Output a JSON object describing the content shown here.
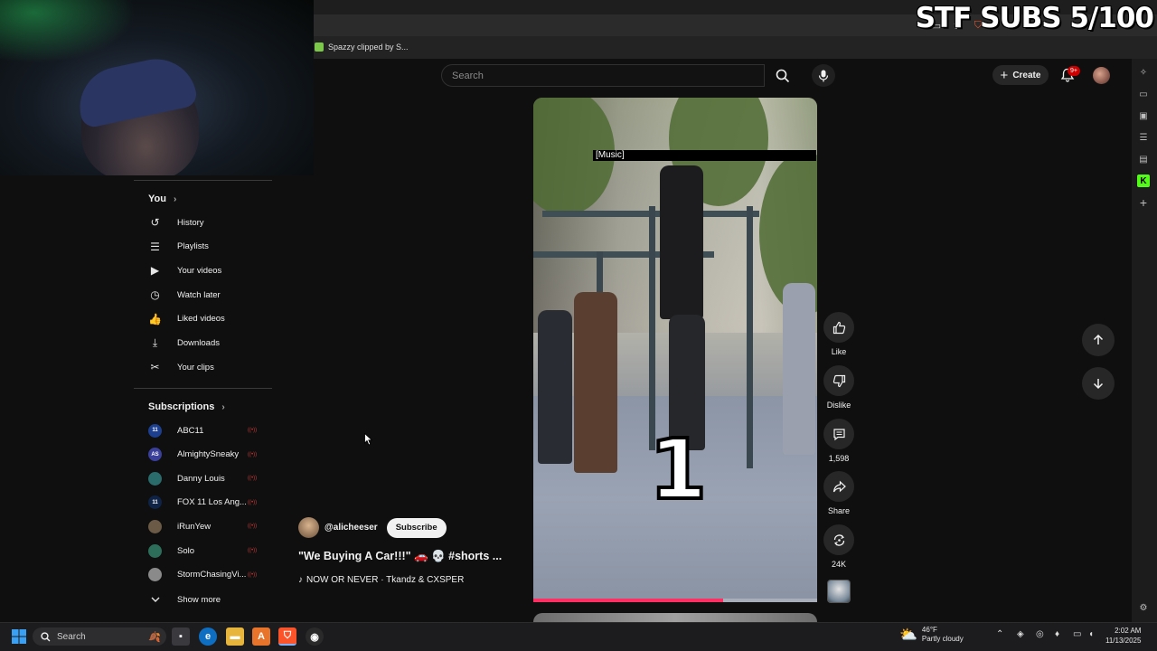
{
  "browser": {
    "bookmark_label": "Spazzy clipped by S...",
    "stream_overlay": "STF SUBS 5/100"
  },
  "masthead": {
    "search_placeholder": "Search",
    "create_label": "Create",
    "notification_badge": "9+"
  },
  "sidebar": {
    "you_heading": "You",
    "you_items": [
      {
        "label": "History",
        "icon": "history-icon"
      },
      {
        "label": "Playlists",
        "icon": "playlists-icon"
      },
      {
        "label": "Your videos",
        "icon": "your-videos-icon"
      },
      {
        "label": "Watch later",
        "icon": "watch-later-icon"
      },
      {
        "label": "Liked videos",
        "icon": "liked-videos-icon"
      },
      {
        "label": "Downloads",
        "icon": "downloads-icon"
      },
      {
        "label": "Your clips",
        "icon": "clips-icon"
      }
    ],
    "subscriptions_heading": "Subscriptions",
    "subscriptions": [
      {
        "label": "ABC11",
        "avatar_color": "#1d3f8f",
        "avatar_text": "11"
      },
      {
        "label": "AlmightySneaky",
        "avatar_color": "#3a3f9a",
        "avatar_text": "AS"
      },
      {
        "label": "Danny Louis",
        "avatar_color": "#2a6b6b",
        "avatar_text": ""
      },
      {
        "label": "FOX 11 Los Ang...",
        "avatar_color": "#0e2346",
        "avatar_text": "11"
      },
      {
        "label": "iRunYew",
        "avatar_color": "#6b5a45",
        "avatar_text": ""
      },
      {
        "label": "Solo",
        "avatar_color": "#2d6e5a",
        "avatar_text": ""
      },
      {
        "label": "StormChasingVi...",
        "avatar_color": "#8a8a8a",
        "avatar_text": ""
      }
    ],
    "show_more": "Show more"
  },
  "video": {
    "caption": "[Music]",
    "overlay_number": "1",
    "progress": 0.67
  },
  "actions": {
    "like_label": "Like",
    "dislike_label": "Dislike",
    "comments_count": "1,598",
    "share_label": "Share",
    "remix_count": "24K"
  },
  "metadata": {
    "channel": "@alicheeser",
    "subscribe_label": "Subscribe",
    "title": "\"We Buying A Car!!!\" 🚗 💀 #shorts ...",
    "music_note": "♪",
    "music": "NOW OR NEVER · Tkandz & CXSPER"
  },
  "taskbar": {
    "search_label": "Search",
    "weather_temp": "46°F",
    "weather_desc": "Partly cloudy",
    "time": "2:02 AM",
    "date": "11/13/2025"
  },
  "colors": {
    "background": "#0f0f0f",
    "accent_red": "#cc0000",
    "progress": "#ff2e63"
  }
}
